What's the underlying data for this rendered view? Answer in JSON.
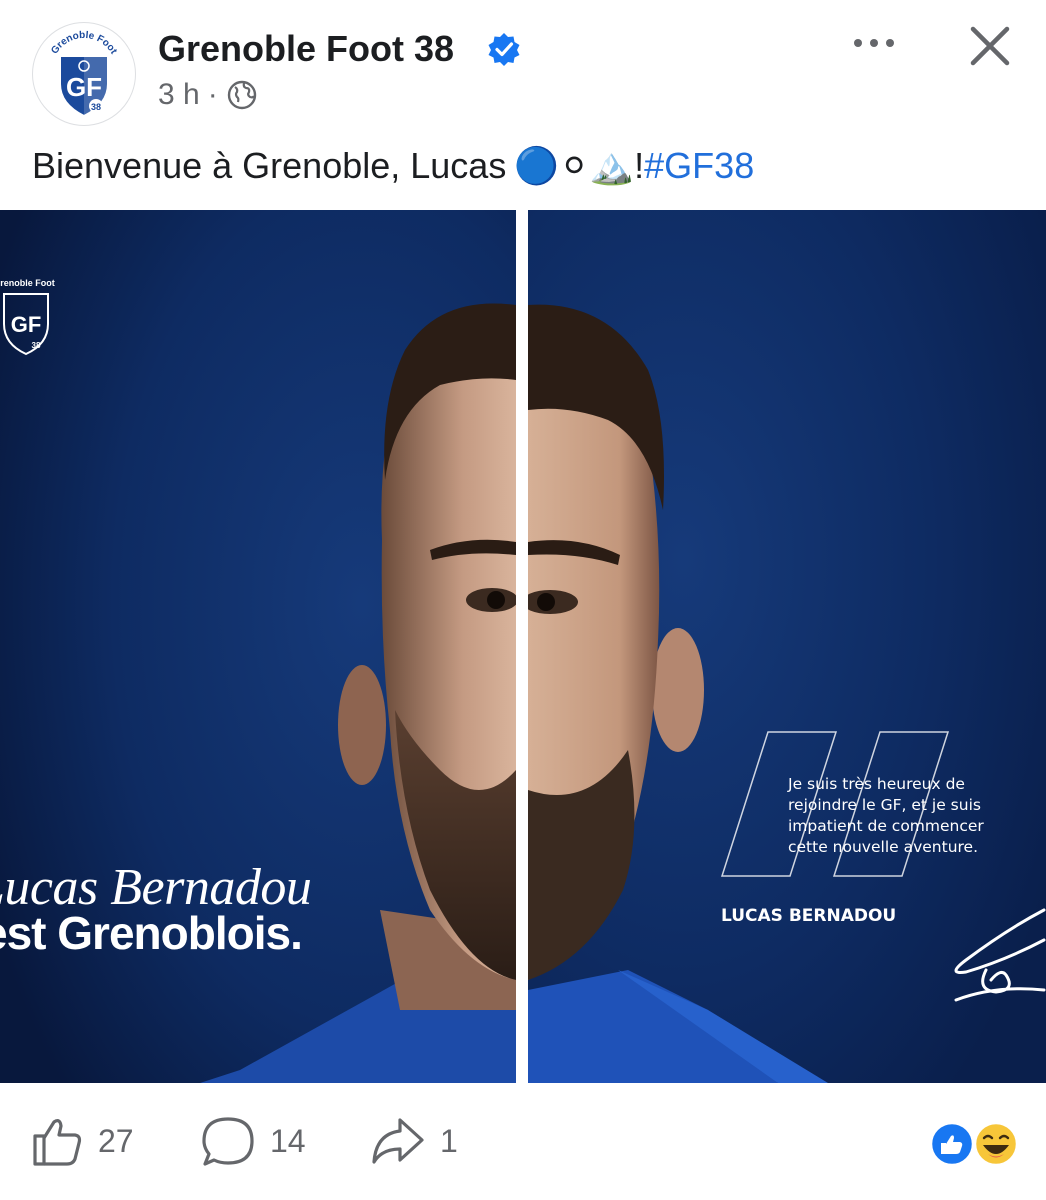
{
  "post": {
    "page_name": "Grenoble Foot 38",
    "verified_icon": "verified-badge-icon",
    "time": "3 h",
    "separator": "·",
    "audience_icon": "globe-icon",
    "caption_text": "Bienvenue à Grenoble, Lucas",
    "caption_emojis": "🔵⚪🏔️",
    "caption_bang": " !",
    "hashtag": "#GF38"
  },
  "logo": {
    "top_text": "Grenoble Foot",
    "initials": "GF",
    "number": "38"
  },
  "graphic": {
    "headline_line1": "Lucas Bernadou",
    "headline_line2": "est Grenoblois.",
    "quote_line1": "Je suis très heureux de",
    "quote_line2": "rejoindre le GF, et je suis",
    "quote_line3": "impatient de commencer",
    "quote_line4": "cette nouvelle aventure.",
    "quote_author": "LUCAS BERNADOU"
  },
  "actions": {
    "likes": "27",
    "comments": "14",
    "shares": "1"
  },
  "colors": {
    "brand_blue": "#1877f2",
    "hashtag": "#216fdb",
    "muted": "#65676b",
    "graphic_bg": "#0d2a63"
  }
}
